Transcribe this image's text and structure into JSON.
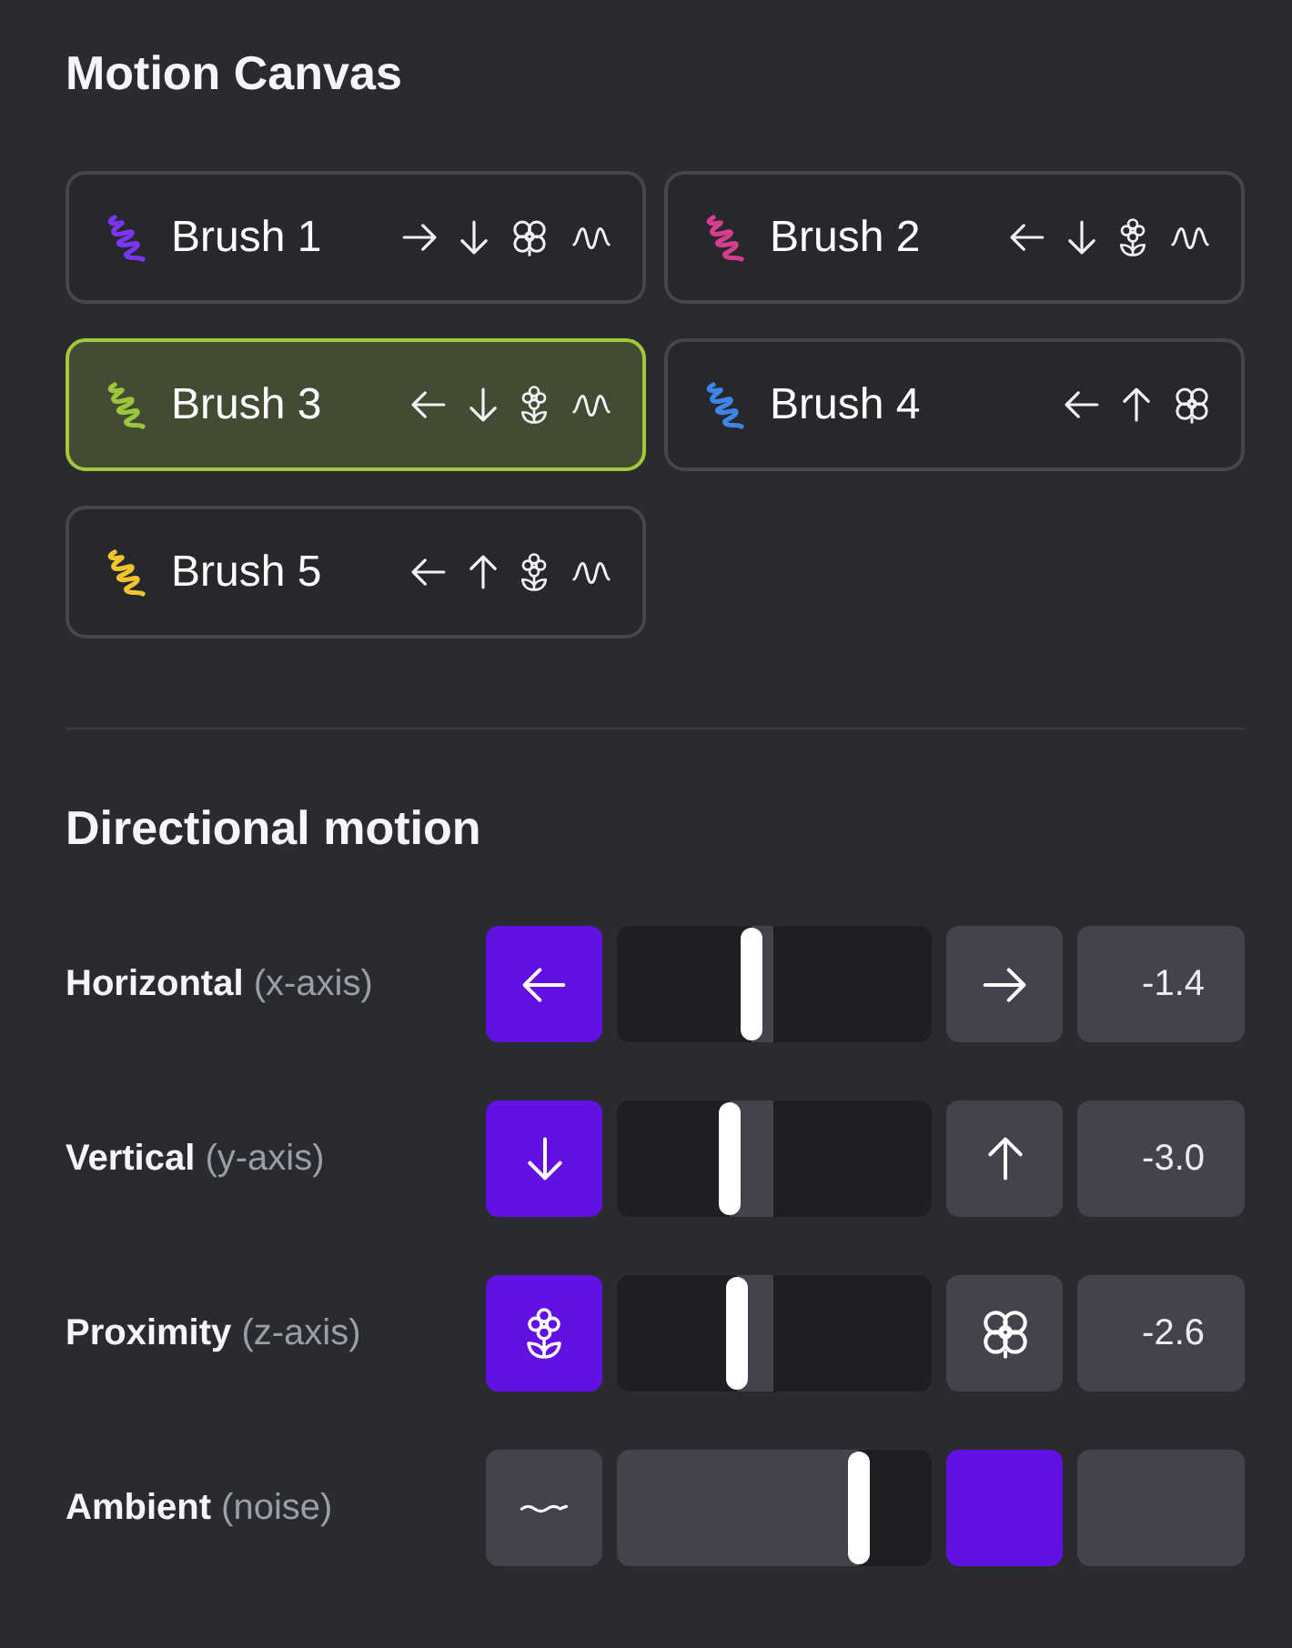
{
  "title": "Motion Canvas",
  "brushes": [
    {
      "name": "Brush 1",
      "color": "#7b35f0",
      "selected": false,
      "x_plus": true,
      "y_plus": false,
      "z_plus": true,
      "ambient": true
    },
    {
      "name": "Brush 2",
      "color": "#d63d8f",
      "selected": false,
      "x_plus": false,
      "y_plus": false,
      "z_plus": false,
      "ambient": true
    },
    {
      "name": "Brush 3",
      "color": "#9bc63a",
      "selected": true,
      "x_plus": false,
      "y_plus": false,
      "z_plus": false,
      "ambient": true
    },
    {
      "name": "Brush 4",
      "color": "#3d84e8",
      "selected": false,
      "x_plus": false,
      "y_plus": true,
      "z_plus": true,
      "ambient": false
    },
    {
      "name": "Brush 5",
      "color": "#f2c530",
      "selected": false,
      "x_plus": false,
      "y_plus": true,
      "z_plus": false,
      "ambient": true
    }
  ],
  "section_title": "Directional motion",
  "axes": [
    {
      "label": "**Horizontal** (x-axis)",
      "kind": "x",
      "buttons": [
        {
          "selected": true
        },
        {
          "selected": false
        }
      ],
      "level": 0.43,
      "reading": "-1.4"
    },
    {
      "label": "**Vertical** (y-axis)",
      "kind": "y",
      "buttons": [
        {
          "selected": true
        },
        {
          "selected": false
        }
      ],
      "level": 0.36,
      "reading": "-3.0"
    },
    {
      "label": "**Proximity** (z-axis)",
      "kind": "z",
      "buttons": [
        {
          "selected": true
        },
        {
          "selected": false
        }
      ],
      "level": 0.38,
      "reading": "-2.6"
    },
    {
      "label": "**Ambient** (noise)",
      "kind": "noise",
      "buttons": [
        {
          "selected": false
        },
        {
          "selected": true
        }
      ],
      "level": 0.77
    }
  ]
}
